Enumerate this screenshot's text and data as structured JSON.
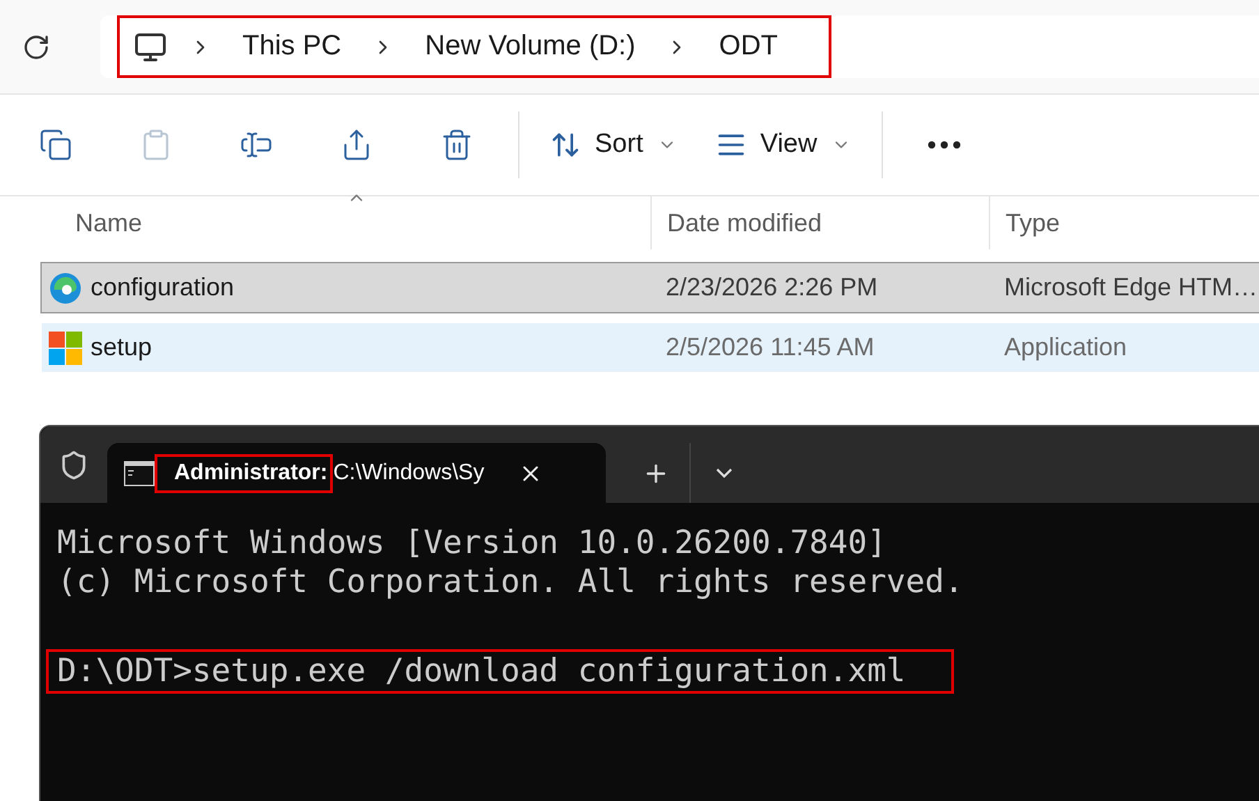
{
  "address_bar": {
    "highlighted": true,
    "crumbs": [
      "This PC",
      "New Volume (D:)",
      "ODT"
    ]
  },
  "toolbar": {
    "actions": [
      {
        "kind": "copy",
        "disabled": false
      },
      {
        "kind": "paste",
        "disabled": true
      },
      {
        "kind": "rename",
        "disabled": false
      },
      {
        "kind": "share",
        "disabled": false
      },
      {
        "kind": "delete",
        "disabled": false
      }
    ],
    "menus": [
      {
        "kind": "sort",
        "label": "Sort"
      },
      {
        "kind": "view",
        "label": "View"
      }
    ]
  },
  "file_list": {
    "columns": [
      "Name",
      "Date modified",
      "Type"
    ],
    "rows": [
      {
        "kind": "edge",
        "name": "configuration",
        "date": "2/23/2026 2:26 PM",
        "type": "Microsoft Edge HTM…",
        "selected": true,
        "hovered": false
      },
      {
        "kind": "windows",
        "name": "setup",
        "date": "2/5/2026 11:45 AM",
        "type": "Application",
        "selected": false,
        "hovered": true
      }
    ]
  },
  "terminal": {
    "tab": {
      "title_parts": [
        {
          "text": "Administrator:",
          "highlighted": true
        },
        {
          "text": "C:\\Windows\\Sy",
          "highlighted": false
        }
      ]
    },
    "lines": [
      {
        "text": "Microsoft Windows [Version 10.0.26200.7840]",
        "highlighted": false
      },
      {
        "text": "(c) Microsoft Corporation. All rights reserved.",
        "highlighted": false
      },
      {
        "text": "D:\\ODT>setup.exe /download configuration.xml",
        "highlighted": true,
        "blank_before": true
      }
    ]
  }
}
